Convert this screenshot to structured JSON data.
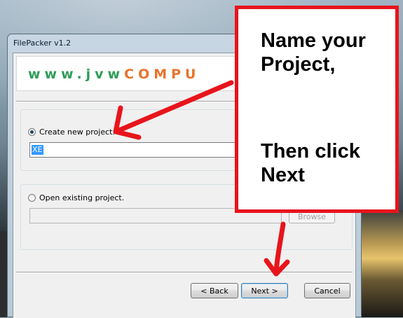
{
  "window": {
    "title": "FilePacker v1.2",
    "banner": {
      "part1": "www.jvw",
      "part2": "COMPU"
    }
  },
  "create": {
    "label": "Create new project.",
    "selected": true,
    "name_value": "XE"
  },
  "open": {
    "label": "Open existing project.",
    "selected": false,
    "path_value": "",
    "browse_label": "Browse"
  },
  "buttons": {
    "back_label": "< Back",
    "next_label": "Next >",
    "cancel_label": "Cancel"
  },
  "annotation": {
    "line1": "Name your\nProject,",
    "line2": "Then click\nNext",
    "color": "#e8141b"
  }
}
